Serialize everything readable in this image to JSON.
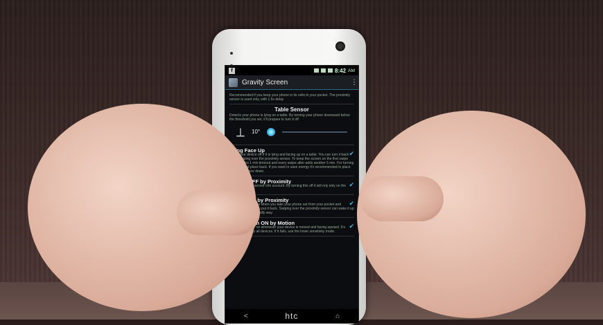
{
  "statusbar": {
    "time": "8:42",
    "ampm": "AM",
    "notification_icon": "f"
  },
  "app": {
    "title": "Gravity Screen"
  },
  "intro_text": "Recommended if you keep your phone in its cells in your pocket. The proximity sensor is used only, with 1.5s delay",
  "table_sensor": {
    "heading": "Table Sensor",
    "desc": "Detects your phone is lying on a table. By turning your phone downward below the threshold you set, it'll prepare to turn it off",
    "angle": "10°"
  },
  "items": [
    {
      "title": "Lying Face Up",
      "desc": "Turns your device off if it is lying and facing up on a table. You can turn it back on by swiping over the proximity sensor. To keep the screen on the first swipe add an extra 1 min timeout and every swipe after adds another 5 min. For turning off lift up and place back. If you want to save energy it's recommended to place your phone face down.",
      "checked": true
    },
    {
      "title": "Screen OFF by Proximity",
      "desc": "Takes proximity sensor into account. By turning this off it will rely only on the gravity sensor",
      "checked": true
    },
    {
      "title": "Screen ON by Proximity",
      "desc": "Turns the screen on when you take your phone out from your pocket and turns it off when you put it back. Swiping over the proximity sensor can wake it up as well. Battery friendly way.",
      "checked": true
    },
    {
      "title": "Turn Screen ON by Motion",
      "desc": "Turns the screen on whenever your device is moved and facing upward. It's not supported by all devices. If it fails, use the lower sensitivity mode.",
      "checked": true
    }
  ],
  "navbar": {
    "back": "<",
    "brand": "htc",
    "home": "⌂"
  }
}
